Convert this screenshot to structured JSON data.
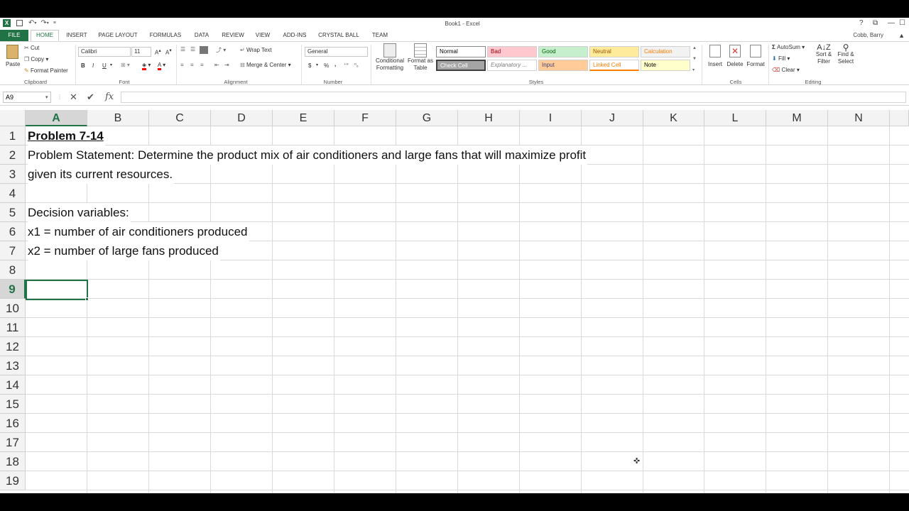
{
  "window": {
    "title": "Book1 - Excel",
    "user": "Cobb, Barry",
    "help": "?",
    "controls": [
      "⧉",
      "—",
      "☐"
    ]
  },
  "tabs": [
    "FILE",
    "HOME",
    "INSERT",
    "PAGE LAYOUT",
    "FORMULAS",
    "DATA",
    "REVIEW",
    "VIEW",
    "ADD-INS",
    "CRYSTAL BALL",
    "TEAM"
  ],
  "ribbon": {
    "clipboard": {
      "label": "Clipboard",
      "paste": "Paste",
      "cut": "Cut",
      "copy": "Copy",
      "format_painter": "Format Painter"
    },
    "font": {
      "label": "Font",
      "name": "Calibri",
      "size": "11",
      "bold": "B",
      "italic": "I",
      "underline": "U"
    },
    "alignment": {
      "label": "Alignment",
      "wrap": "Wrap Text",
      "merge": "Merge & Center"
    },
    "number": {
      "label": "Number",
      "format": "General",
      "currency": "$",
      "percent": "%",
      "comma": ","
    },
    "styles": {
      "label": "Styles",
      "conditional": "Conditional Formatting",
      "format_table": "Format as Table",
      "cells": [
        {
          "name": "Normal",
          "bg": "#ffffff",
          "fg": "#000000"
        },
        {
          "name": "Bad",
          "bg": "#ffc7ce",
          "fg": "#9c0006"
        },
        {
          "name": "Good",
          "bg": "#c6efce",
          "fg": "#006100"
        },
        {
          "name": "Neutral",
          "bg": "#ffeb9c",
          "fg": "#9c5700"
        },
        {
          "name": "Calculation",
          "bg": "#f2f2f2",
          "fg": "#fa7d00"
        },
        {
          "name": "Check Cell",
          "bg": "#a5a5a5",
          "fg": "#ffffff"
        },
        {
          "name": "Explanatory ...",
          "bg": "#ffffff",
          "fg": "#7f7f7f"
        },
        {
          "name": "Input",
          "bg": "#ffcc99",
          "fg": "#3f3f76"
        },
        {
          "name": "Linked Cell",
          "bg": "#ffffff",
          "fg": "#fa7d00"
        },
        {
          "name": "Note",
          "bg": "#ffffcc",
          "fg": "#000000"
        }
      ]
    },
    "cells": {
      "label": "Cells",
      "insert": "Insert",
      "delete": "Delete",
      "format": "Format"
    },
    "editing": {
      "label": "Editing",
      "autosum": "AutoSum",
      "fill": "Fill",
      "clear": "Clear",
      "sort": "Sort & Filter",
      "find": "Find & Select"
    }
  },
  "formula_bar": {
    "name_box": "A9",
    "fx": "fx",
    "value": ""
  },
  "columns": [
    "A",
    "B",
    "C",
    "D",
    "E",
    "F",
    "G",
    "H",
    "I",
    "J",
    "K",
    "L",
    "M",
    "N"
  ],
  "rows": [
    "1",
    "2",
    "3",
    "4",
    "5",
    "6",
    "7",
    "8",
    "9",
    "10",
    "11",
    "12",
    "13",
    "14",
    "15",
    "16",
    "17",
    "18",
    "19"
  ],
  "selected": {
    "column": "A",
    "row": "9"
  },
  "cells": {
    "A1": "Problem 7-14",
    "A2": "Problem Statement: Determine the product mix of air conditioners and large fans that will maximize profit",
    "A3": "given its current resources.",
    "A5": "Decision variables:",
    "A6": "x1 = number of air conditioners produced",
    "A7": "x2 = number of large fans produced"
  },
  "colors": {
    "accent": "#217346",
    "grid": "#d9d9d9",
    "header_bg": "#f3f3f3"
  }
}
